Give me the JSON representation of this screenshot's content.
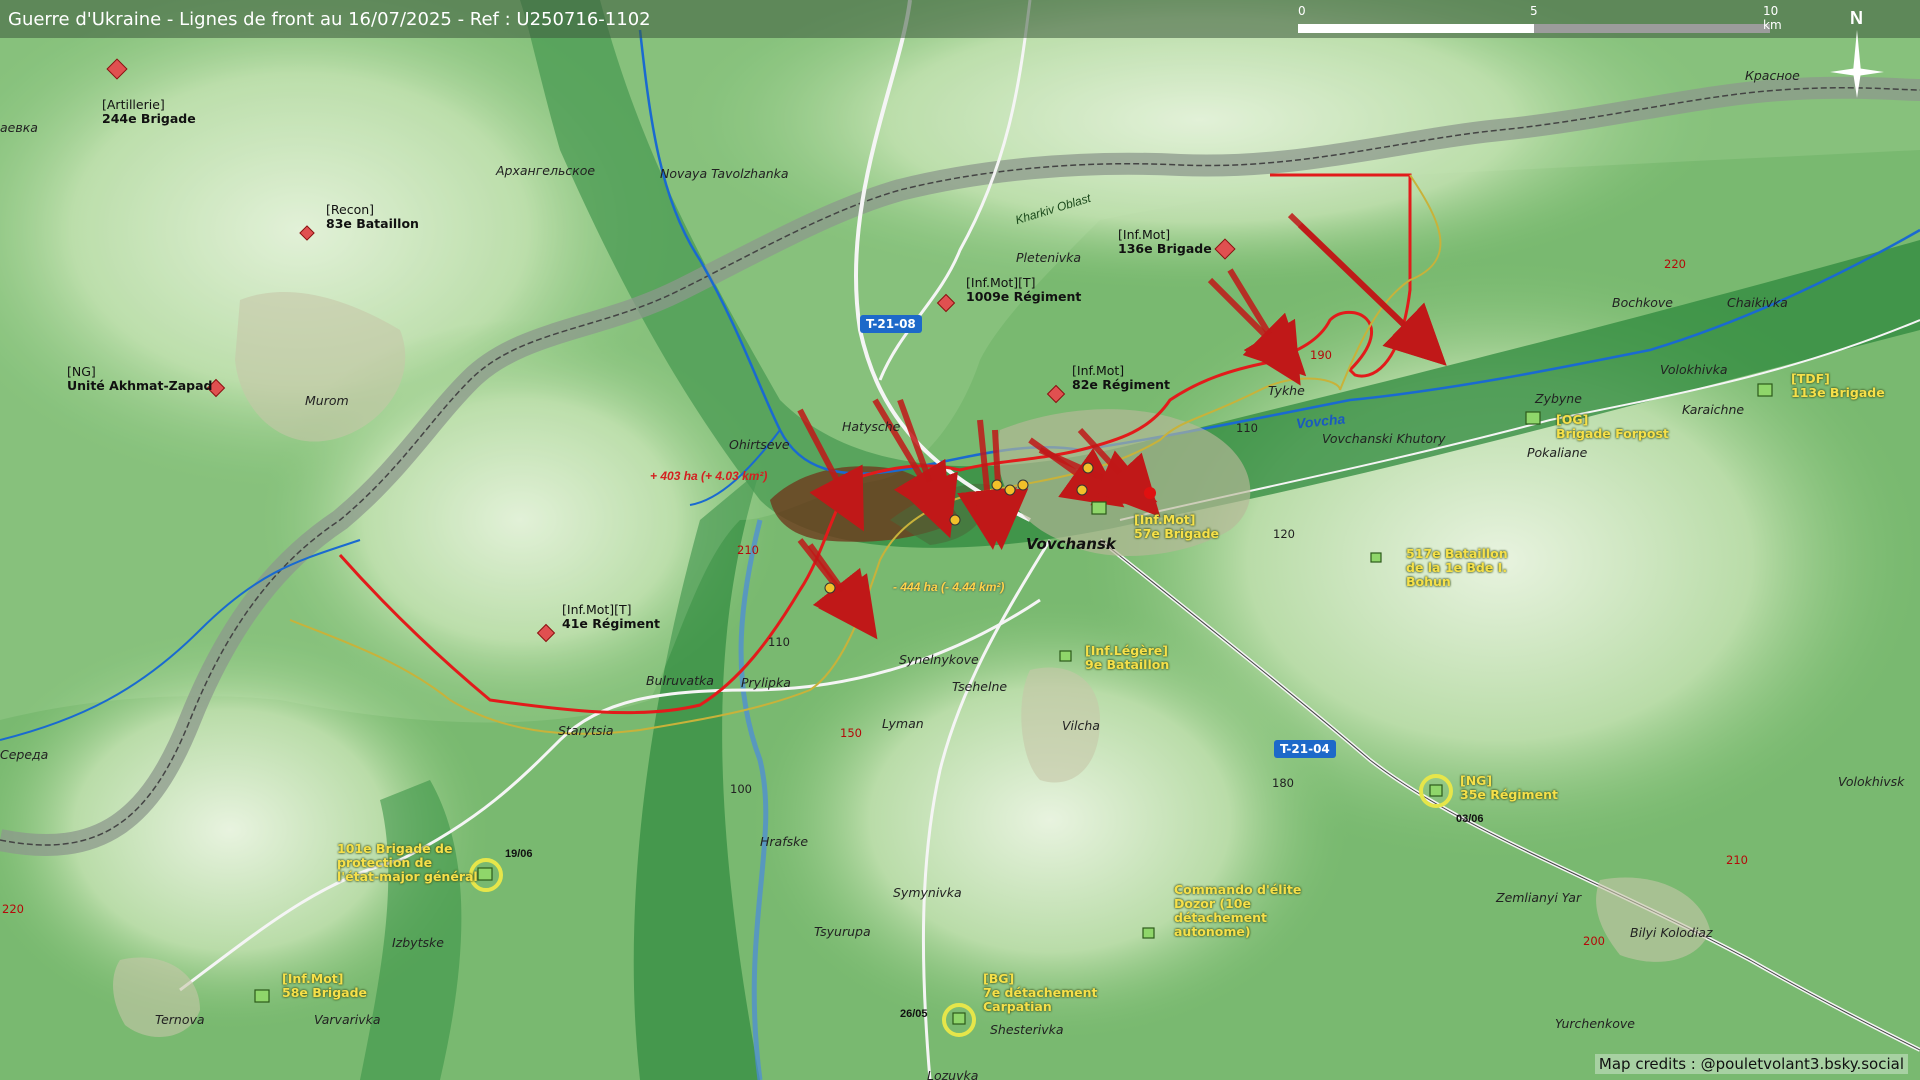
{
  "title": "Guerre d'Ukraine - Lignes de front au 16/07/2025 - Ref : U250716-1102",
  "scale": {
    "labels": [
      "0",
      "5",
      "10 km"
    ]
  },
  "north": "N",
  "credits": "Map credits : @pouletvolant3.bsky.social",
  "colors": {
    "russian": "#e05050",
    "ukrainian": "#8fd66a",
    "front": "#e01818",
    "river": "#1a6ad0",
    "border": "#7a8a7a"
  },
  "russian_units": [
    {
      "type": "[Artillerie]",
      "name": "244e Brigade"
    },
    {
      "type": "[Recon]",
      "name": "83e Bataillon"
    },
    {
      "type": "[NG]",
      "name": "Unité Akhmat-Zapad"
    },
    {
      "type": "[Inf.Mot][T]",
      "name": "41e Régiment"
    },
    {
      "type": "[Inf.Mot][T]",
      "name": "1009e Régiment"
    },
    {
      "type": "[Inf.Mot]",
      "name": "82e Régiment"
    },
    {
      "type": "[Inf.Mot]",
      "name": "136e Brigade"
    }
  ],
  "ukrainian_units": [
    {
      "lines": [
        "[Inf.Mot]",
        "57e Brigade"
      ]
    },
    {
      "lines": [
        "517e Bataillon",
        "de la 1e Bde I.",
        "Bohun"
      ]
    },
    {
      "lines": [
        "[Inf.Légère]",
        "9e Bataillon"
      ]
    },
    {
      "lines": [
        "[OG]",
        "Brigade Forpost"
      ]
    },
    {
      "lines": [
        "[TDF]",
        "113e Brigade"
      ]
    },
    {
      "lines": [
        "[NG]",
        "35e Régiment"
      ]
    },
    {
      "lines": [
        "101e Brigade de",
        "protection de",
        "l'état-major général"
      ]
    },
    {
      "lines": [
        "Commando d'élite",
        "Dozor (10e",
        "détachement",
        "autonome)"
      ]
    },
    {
      "lines": [
        "[BG]",
        "7e détachement",
        "Carpatian"
      ]
    },
    {
      "lines": [
        "[Inf.Mot]",
        "58e Brigade"
      ]
    }
  ],
  "dates": [
    "19/06",
    "03/06",
    "26/05"
  ],
  "places": [
    "Красное",
    "Архангельское",
    "Novaya Tavolzhanka",
    "Pletenivka",
    "Murom",
    "Hatysche",
    "Ohirtseve",
    "Tykhe",
    "Vovchanski Khutory",
    "Pokaliane",
    "Zybyne",
    "Volokhivka",
    "Bochkove",
    "Chaikivka",
    "Karaichne",
    "Vovchansk",
    "Bulruvatka",
    "Prylipka",
    "Starytsia",
    "Synelnykove",
    "Tsehelne",
    "Lyman",
    "Vilcha",
    "Hrafske",
    "Symynivka",
    "Tsyurupa",
    "Shesterivka",
    "Lozuvka",
    "Izbytske",
    "Ternova",
    "Varvarivka",
    "Zemlianyi Yar",
    "Bilyi Kolodiaz",
    "Yurchenkove",
    "Volokhivsk",
    "аевка",
    "Середа"
  ],
  "roads": [
    "T-21-08",
    "T-21-04"
  ],
  "elevations": {
    "red": [
      "220",
      "190",
      "210",
      "150",
      "220",
      "210",
      "200"
    ],
    "black": [
      "120",
      "110",
      "110",
      "100",
      "180"
    ]
  },
  "river_name": "Vovcha",
  "oblast": "Kharkiv Oblast",
  "area_gain": "+ 403 ha (+ 4.03 km²)",
  "area_loss": "- 444 ha (- 4.44 km²)"
}
